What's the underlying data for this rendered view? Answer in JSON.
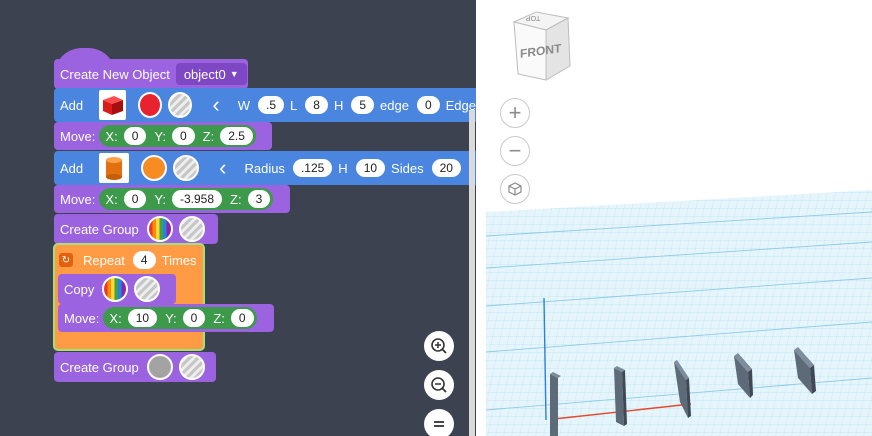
{
  "workspace": {
    "create_object": {
      "label": "Create New Object",
      "object_name": "object0"
    },
    "add_box": {
      "label": "Add",
      "shape_icon": "red-box-icon",
      "color": "#e8232f",
      "params": [
        {
          "name": "W",
          "value": ".5"
        },
        {
          "name": "L",
          "value": "8"
        },
        {
          "name": "H",
          "value": "5"
        },
        {
          "name": "edge",
          "value": "0"
        },
        {
          "name": "Edge",
          "value": ""
        }
      ]
    },
    "move_1": {
      "label": "Move:",
      "x": "0",
      "y": "0",
      "z": "2.5"
    },
    "add_cylinder": {
      "label": "Add",
      "shape_icon": "orange-cylinder-icon",
      "color": "#f88c24",
      "params": [
        {
          "name": "Radius",
          "value": ".125"
        },
        {
          "name": "H",
          "value": "10"
        },
        {
          "name": "Sides",
          "value": "20"
        }
      ]
    },
    "move_2": {
      "label": "Move:",
      "x": "0",
      "y": "-3.958",
      "z": "3"
    },
    "create_group_1": {
      "label": "Create Group"
    },
    "repeat": {
      "label": "Repeat",
      "count": "4",
      "suffix": "Times"
    },
    "copy": {
      "label": "Copy"
    },
    "move_3": {
      "label": "Move:",
      "x": "10",
      "y": "0",
      "z": "0"
    },
    "create_group_2": {
      "label": "Create Group"
    },
    "axis_labels": {
      "x": "X:",
      "y": "Y:",
      "z": "Z:"
    }
  },
  "zoom_controls": [
    "zoom-in-icon",
    "zoom-out-icon",
    "zoom-reset-icon"
  ],
  "viewport": {
    "view_cube": {
      "front": "FRONT",
      "top": "TOP"
    },
    "nav_controls": [
      "plus-icon",
      "minus-icon",
      "cube-icon"
    ],
    "grid_color": "#9cd4ee",
    "plate_color": "#5d6a78",
    "axis_colors": {
      "x": "#e5482a",
      "y": "#2d7fe0",
      "z": "#3e9a4b"
    }
  }
}
